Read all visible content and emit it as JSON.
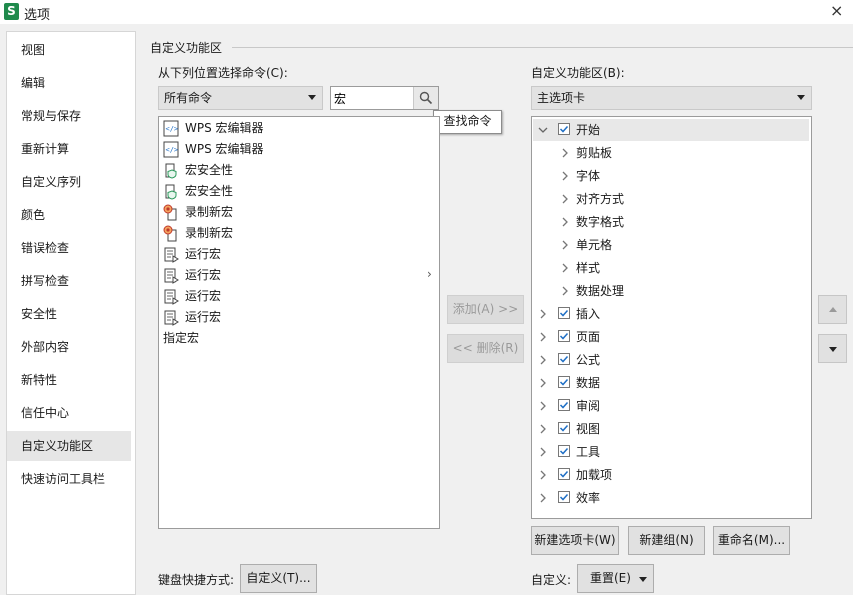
{
  "window": {
    "app_icon_letter": "S",
    "title": "选项",
    "close_symbol": "×"
  },
  "sidebar": {
    "items": [
      {
        "label": "视图"
      },
      {
        "label": "编辑"
      },
      {
        "label": "常规与保存"
      },
      {
        "label": "重新计算"
      },
      {
        "label": "自定义序列"
      },
      {
        "label": "颜色"
      },
      {
        "label": "错误检查"
      },
      {
        "label": "拼写检查"
      },
      {
        "label": "安全性"
      },
      {
        "label": "外部内容"
      },
      {
        "label": "新特性"
      },
      {
        "label": "信任中心"
      },
      {
        "label": "自定义功能区",
        "selected": true
      },
      {
        "label": "快速访问工具栏"
      }
    ]
  },
  "main": {
    "section_title": "自定义功能区",
    "choose_from_label": "从下列位置选择命令(C):",
    "choose_from_value": "所有命令",
    "search_value": "宏",
    "search_tooltip": "查找命令",
    "commands": [
      {
        "label": "WPS 宏编辑器",
        "icon": "macro-editor-icon"
      },
      {
        "label": "WPS 宏编辑器",
        "icon": "macro-editor-icon"
      },
      {
        "label": "宏安全性",
        "icon": "macro-security-icon"
      },
      {
        "label": "宏安全性",
        "icon": "macro-security-icon"
      },
      {
        "label": "录制新宏",
        "icon": "record-macro-icon"
      },
      {
        "label": "录制新宏",
        "icon": "record-macro-icon"
      },
      {
        "label": "运行宏",
        "icon": "run-macro-icon"
      },
      {
        "label": "运行宏",
        "icon": "run-macro-icon",
        "submenu_arrow": "›"
      },
      {
        "label": "运行宏",
        "icon": "run-macro-icon"
      },
      {
        "label": "运行宏",
        "icon": "run-macro-icon"
      },
      {
        "label": "指定宏",
        "icon": ""
      }
    ],
    "add_button": "添加(A) >>",
    "remove_button": "<< 删除(R)",
    "customize_ribbon_label": "自定义功能区(B):",
    "ribbon_scope_value": "主选项卡",
    "tree": [
      {
        "label": "开始",
        "checked": true,
        "expanded": true,
        "children": [
          "剪贴板",
          "字体",
          "对齐方式",
          "数字格式",
          "单元格",
          "样式",
          "数据处理"
        ]
      },
      {
        "label": "插入",
        "checked": true
      },
      {
        "label": "页面",
        "checked": true
      },
      {
        "label": "公式",
        "checked": true
      },
      {
        "label": "数据",
        "checked": true
      },
      {
        "label": "审阅",
        "checked": true
      },
      {
        "label": "视图",
        "checked": true
      },
      {
        "label": "工具",
        "checked": true
      },
      {
        "label": "加载项",
        "checked": true
      },
      {
        "label": "效率",
        "checked": true
      }
    ],
    "new_tab_button": "新建选项卡(W)",
    "new_group_button": "新建组(N)",
    "rename_button": "重命名(M)...",
    "keyboard_shortcut_label": "键盘快捷方式:",
    "customize_button": "自定义(T)...",
    "customize_label": "自定义:",
    "reset_button": "重置(E)",
    "colors": {
      "accent_check": "#1f6fc5",
      "app_icon_bg": "#1f8a4c"
    }
  }
}
